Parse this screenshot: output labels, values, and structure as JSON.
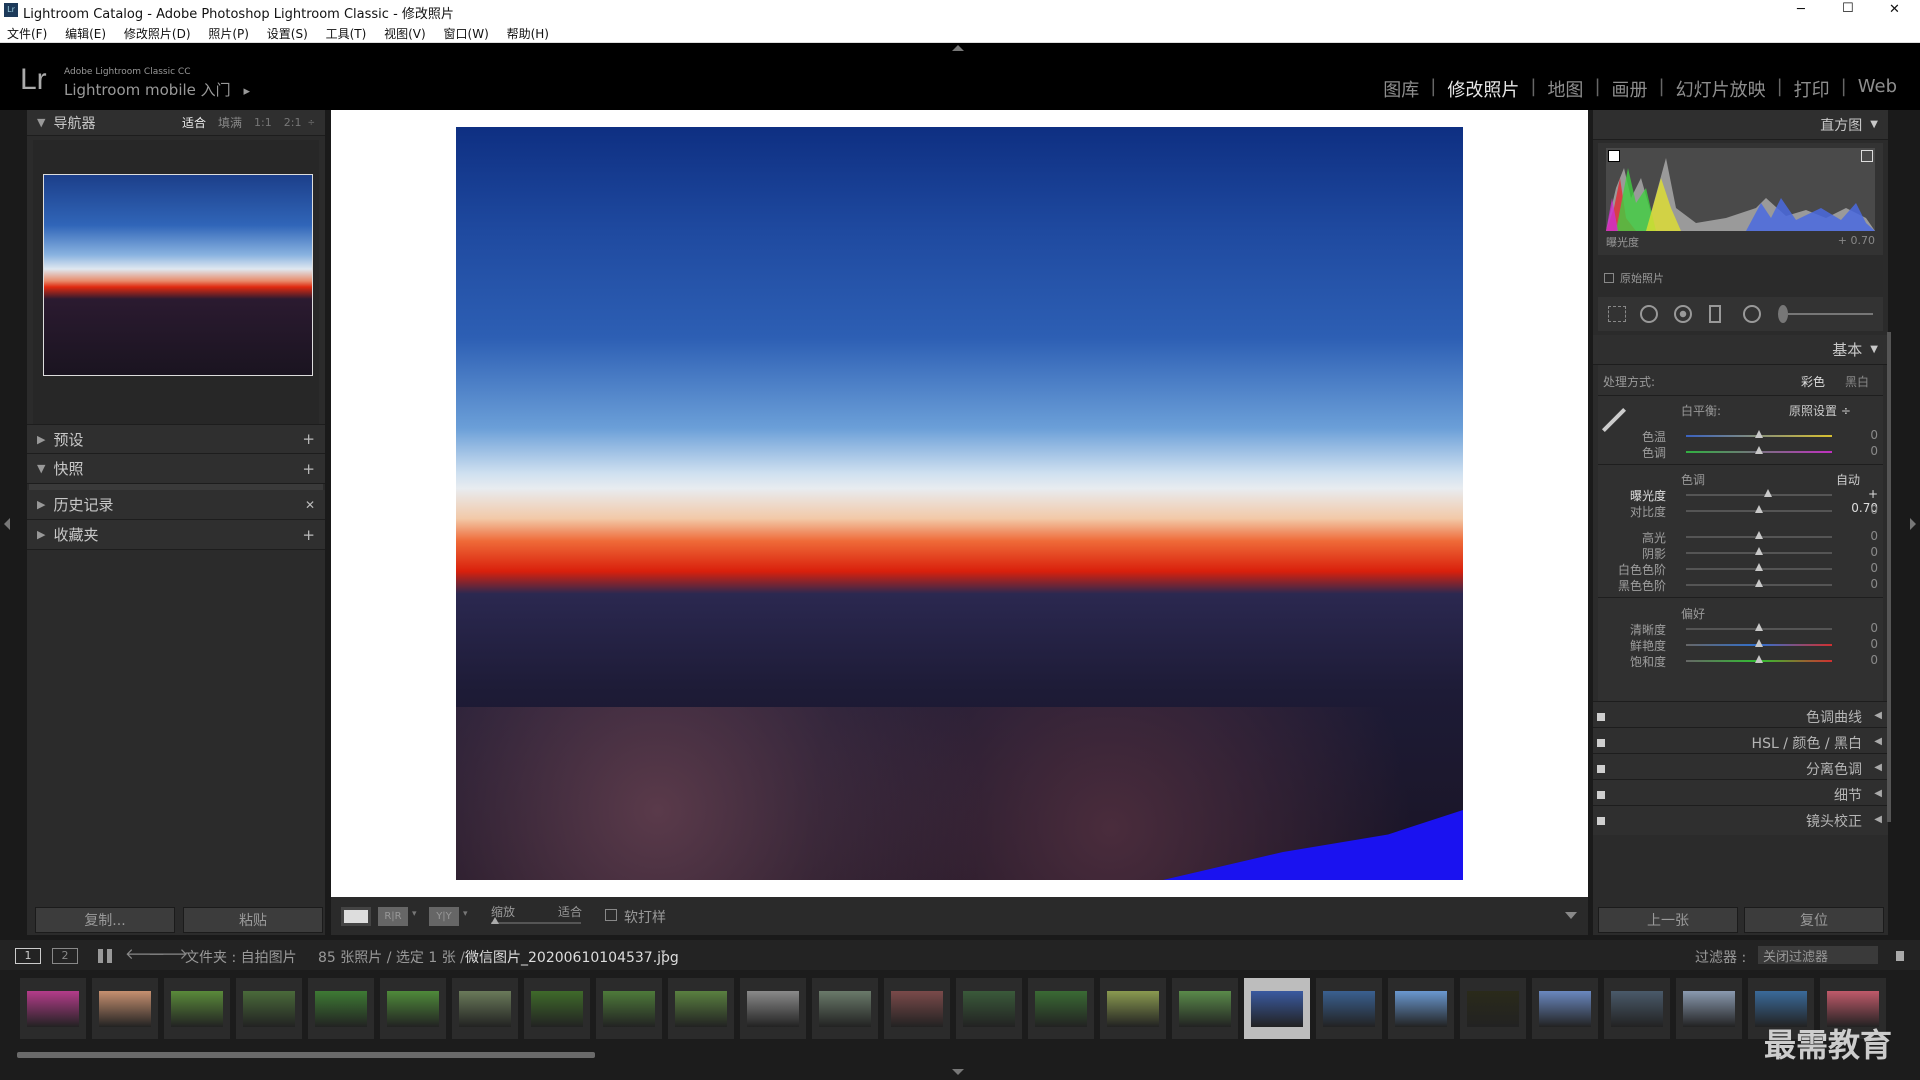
{
  "window": {
    "title": "Lightroom Catalog - Adobe Photoshop Lightroom Classic - 修改照片",
    "min": "─",
    "max": "☐",
    "close": "✕"
  },
  "menu": [
    "文件(F)",
    "编辑(E)",
    "修改照片(D)",
    "照片(P)",
    "设置(S)",
    "工具(T)",
    "视图(V)",
    "窗口(W)",
    "帮助(H)"
  ],
  "identity": {
    "logo": "Lr",
    "product": "Adobe Lightroom Classic CC",
    "mobile": "Lightroom mobile 入门",
    "mobile_arrow": "▸"
  },
  "modules": [
    "图库",
    "修改照片",
    "地图",
    "画册",
    "幻灯片放映",
    "打印",
    "Web"
  ],
  "navigator": {
    "title": "导航器",
    "zoom": [
      "适合",
      "填满",
      "1:1",
      "2:1"
    ]
  },
  "left_sections": [
    {
      "label": "预设",
      "action": "+"
    },
    {
      "label": "快照",
      "action": "+"
    },
    {
      "label": "历史记录",
      "action": "✕"
    },
    {
      "label": "收藏夹",
      "action": "+"
    }
  ],
  "left_buttons": {
    "copy": "复制...",
    "paste": "粘贴"
  },
  "toolbar": {
    "zoom_label": "缩放",
    "zoom_value": "适合",
    "softproof": "软打样"
  },
  "histogram": {
    "title": "直方图",
    "exposure_label": "曝光度",
    "exposure_value": "+ 0.70",
    "original": "原始照片"
  },
  "basic": {
    "title": "基本",
    "treatment_label": "处理方式:",
    "treatment_color": "彩色",
    "treatment_bw": "黑白",
    "wb_label": "白平衡:",
    "wb_value": "原照设置 ÷",
    "tone_label": "色调",
    "auto": "自动",
    "presence_label": "偏好",
    "wb_sliders": [
      {
        "label": "色温",
        "value": "0",
        "pos": 0.5
      },
      {
        "label": "色调",
        "value": "0",
        "pos": 0.5
      }
    ],
    "tone_sliders": [
      {
        "label": "曝光度",
        "value": "+ 0.70",
        "pos": 0.57
      },
      {
        "label": "对比度",
        "value": "0",
        "pos": 0.5
      }
    ],
    "tone2_sliders": [
      {
        "label": "高光",
        "value": "0",
        "pos": 0.5
      },
      {
        "label": "阴影",
        "value": "0",
        "pos": 0.5
      },
      {
        "label": "白色色阶",
        "value": "0",
        "pos": 0.5
      },
      {
        "label": "黑色色阶",
        "value": "0",
        "pos": 0.5
      }
    ],
    "presence_sliders": [
      {
        "label": "清晰度",
        "value": "0",
        "pos": 0.5
      },
      {
        "label": "鲜艳度",
        "value": "0",
        "pos": 0.5
      },
      {
        "label": "饱和度",
        "value": "0",
        "pos": 0.5
      }
    ]
  },
  "right_sections": [
    "色调曲线",
    "HSL / 颜色 / 黑白",
    "分离色调",
    "细节",
    "镜头校正"
  ],
  "right_buttons": {
    "prev": "上一张",
    "reset": "复位"
  },
  "filmstrip_header": {
    "page1": "1",
    "page2": "2",
    "source": "文件夹 : 自拍图片",
    "count": "85 张照片 / 选定 1 张 /",
    "filename": "微信图片_20200610104537.jpg",
    "filter_label": "过滤器 :",
    "filter_value": "关闭过滤器"
  },
  "filmstrip": {
    "selected_index": 17,
    "colors": [
      "#b43c8a",
      "#c79070",
      "#5a8a3a",
      "#4a6a3a",
      "#3e7a34",
      "#4f8a3a",
      "#6a7a5a",
      "#3f6a2a",
      "#4e7a3a",
      "#5a8040",
      "#8a8a8a",
      "#6a7a6a",
      "#7a4a4a",
      "#3a5a3a",
      "#3a6a34",
      "#8a9a50",
      "#5a8a4a",
      "#3a5aa0",
      "#3a6090",
      "#6a98d0",
      "#2a2a1a",
      "#6a88c0",
      "#4a5a6a",
      "#8a9ab0",
      "#3a6a9a",
      "#c05a6a"
    ]
  },
  "watermark": "最需教育"
}
